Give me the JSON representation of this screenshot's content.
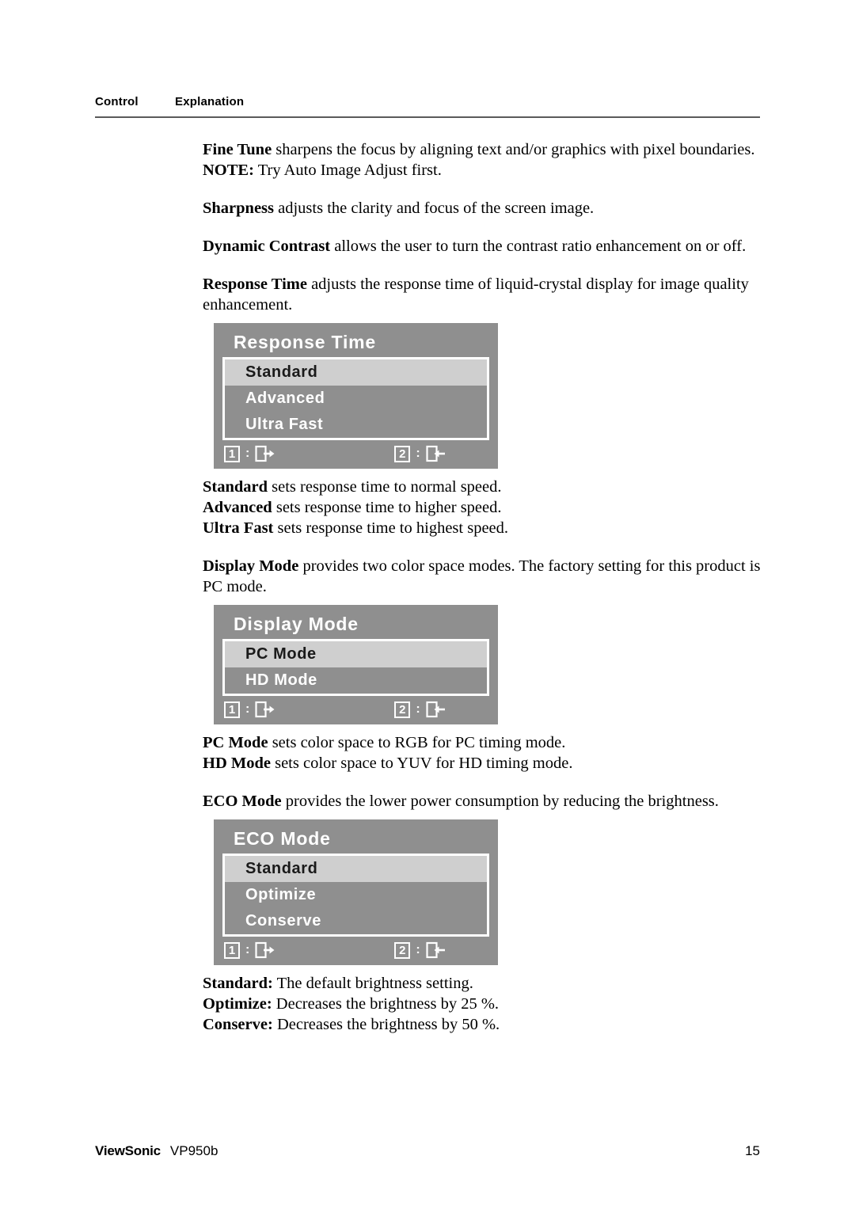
{
  "header": {
    "col_control": "Control",
    "col_explanation": "Explanation"
  },
  "body_blocks": {
    "fine_tune_term": "Fine Tune",
    "fine_tune_text": " sharpens the focus by aligning text and/or graphics with pixel boundaries.",
    "note_term": "NOTE:",
    "note_text": " Try Auto Image Adjust first.",
    "sharpness_term": "Sharpness",
    "sharpness_text": " adjusts the clarity and focus of the screen image.",
    "dynamic_contrast_term": "Dynamic Contrast",
    "dynamic_contrast_text": " allows the user to turn the contrast ratio enhancement on or off.",
    "response_time_term": "Response Time",
    "response_time_text": " adjusts the response time of liquid-crystal display for image quality enhancement.",
    "standard_term": "Standard",
    "standard_text": " sets response time to normal speed.",
    "advanced_term": "Advanced",
    "advanced_text": " sets response time to higher speed.",
    "ultra_fast_term": "Ultra Fast",
    "ultra_fast_text": " sets response time to highest speed.",
    "display_mode_term": "Display Mode",
    "display_mode_text": " provides two color space modes. The factory setting for this product is PC mode.",
    "pc_mode_term": "PC Mode",
    "pc_mode_text": " sets color space to RGB for PC timing mode.",
    "hd_mode_term": "HD Mode",
    "hd_mode_text": " sets color space to YUV for HD timing mode.",
    "eco_mode_term": "ECO Mode",
    "eco_mode_text": " provides the lower power consumption by reducing the brightness.",
    "eco_standard_term": "Standard:",
    "eco_standard_text": " The default brightness setting.",
    "eco_optimize_term": "Optimize:",
    "eco_optimize_text": " Decreases the brightness by 25 %.",
    "eco_conserve_term": "Conserve:",
    "eco_conserve_text": " Decreases the brightness by 50 %."
  },
  "osd_menus": [
    {
      "title": "Response Time",
      "items": [
        {
          "label": "Standard",
          "selected": true
        },
        {
          "label": "Advanced",
          "selected": false
        },
        {
          "label": "Ultra Fast",
          "selected": false
        }
      ],
      "footer": {
        "key1": "1",
        "colon1": ":",
        "icon1": "exit-right-icon",
        "key2": "2",
        "colon2": ":",
        "icon2": "enter-left-icon"
      }
    },
    {
      "title": "Display Mode",
      "items": [
        {
          "label": "PC Mode",
          "selected": true
        },
        {
          "label": "HD Mode",
          "selected": false
        }
      ],
      "footer": {
        "key1": "1",
        "colon1": ":",
        "icon1": "exit-right-icon",
        "key2": "2",
        "colon2": ":",
        "icon2": "enter-left-icon"
      }
    },
    {
      "title": "ECO Mode",
      "items": [
        {
          "label": "Standard",
          "selected": true
        },
        {
          "label": "Optimize",
          "selected": false
        },
        {
          "label": "Conserve",
          "selected": false
        }
      ],
      "footer": {
        "key1": "1",
        "colon1": ":",
        "icon1": "exit-right-icon",
        "key2": "2",
        "colon2": ":",
        "icon2": "enter-left-icon"
      }
    }
  ],
  "footer": {
    "brand": "ViewSonic",
    "model": "VP950b",
    "page_number": "15"
  },
  "colors": {
    "osd_background": "#8f8f8f",
    "osd_selected_row": "#cfcfcf",
    "osd_text": "#ffffff",
    "osd_selected_text": "#1a1a1a",
    "rule": "#5a5a5a",
    "page_background": "#ffffff"
  }
}
